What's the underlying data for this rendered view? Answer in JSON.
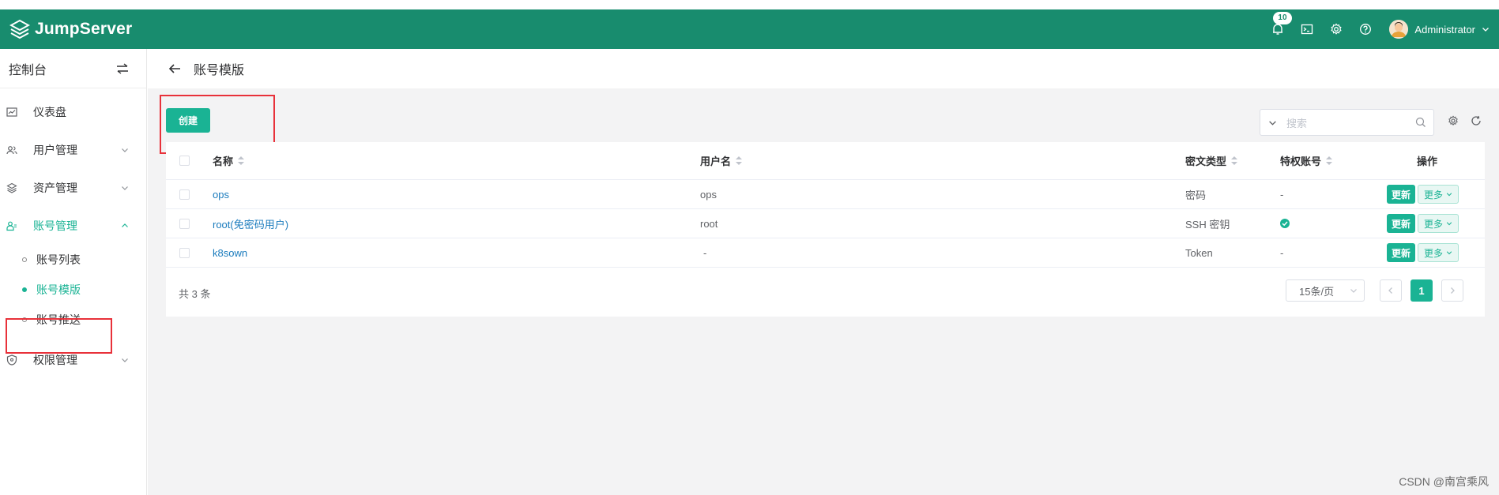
{
  "topbar": {
    "brand": "JumpServer",
    "notification_count": "10",
    "username": "Administrator",
    "icons": [
      "bell-icon",
      "terminal-icon",
      "gear-icon",
      "help-icon",
      "chevron-down-icon"
    ]
  },
  "sidebar": {
    "title": "控制台",
    "items": [
      {
        "label": "仪表盘",
        "icon": "dashboard-icon"
      },
      {
        "label": "用户管理",
        "icon": "users-icon"
      },
      {
        "label": "资产管理",
        "icon": "assets-icon"
      },
      {
        "label": "账号管理",
        "icon": "accounts-icon",
        "active": true,
        "children": [
          {
            "label": "账号列表"
          },
          {
            "label": "账号模版",
            "active": true
          },
          {
            "label": "账号推送"
          }
        ]
      },
      {
        "label": "权限管理",
        "icon": "shield-icon"
      }
    ]
  },
  "page": {
    "title": "账号模版",
    "create_label": "创建",
    "search_placeholder": "搜索"
  },
  "table": {
    "headers": {
      "name": "名称",
      "username": "用户名",
      "secret_type": "密文类型",
      "privileged": "特权账号",
      "actions": "操作"
    },
    "rows": [
      {
        "name": "ops",
        "username": "ops",
        "secret_type": "密码",
        "privileged": "-",
        "update": "更新",
        "more": "更多"
      },
      {
        "name": "root(免密码用户)",
        "username": "root",
        "secret_type": "SSH 密钥",
        "privileged": "check",
        "update": "更新",
        "more": "更多"
      },
      {
        "name": "k8sown",
        "username": "-",
        "secret_type": "Token",
        "privileged": "-",
        "update": "更新",
        "more": "更多"
      }
    ],
    "total": "共 3 条",
    "page_size": "15条/页",
    "current_page": "1"
  },
  "watermark": "CSDN @南宫乘风",
  "colors": {
    "primary": "#1ab394",
    "topbar": "#188c6e",
    "highlight_box": "#e8313a"
  }
}
